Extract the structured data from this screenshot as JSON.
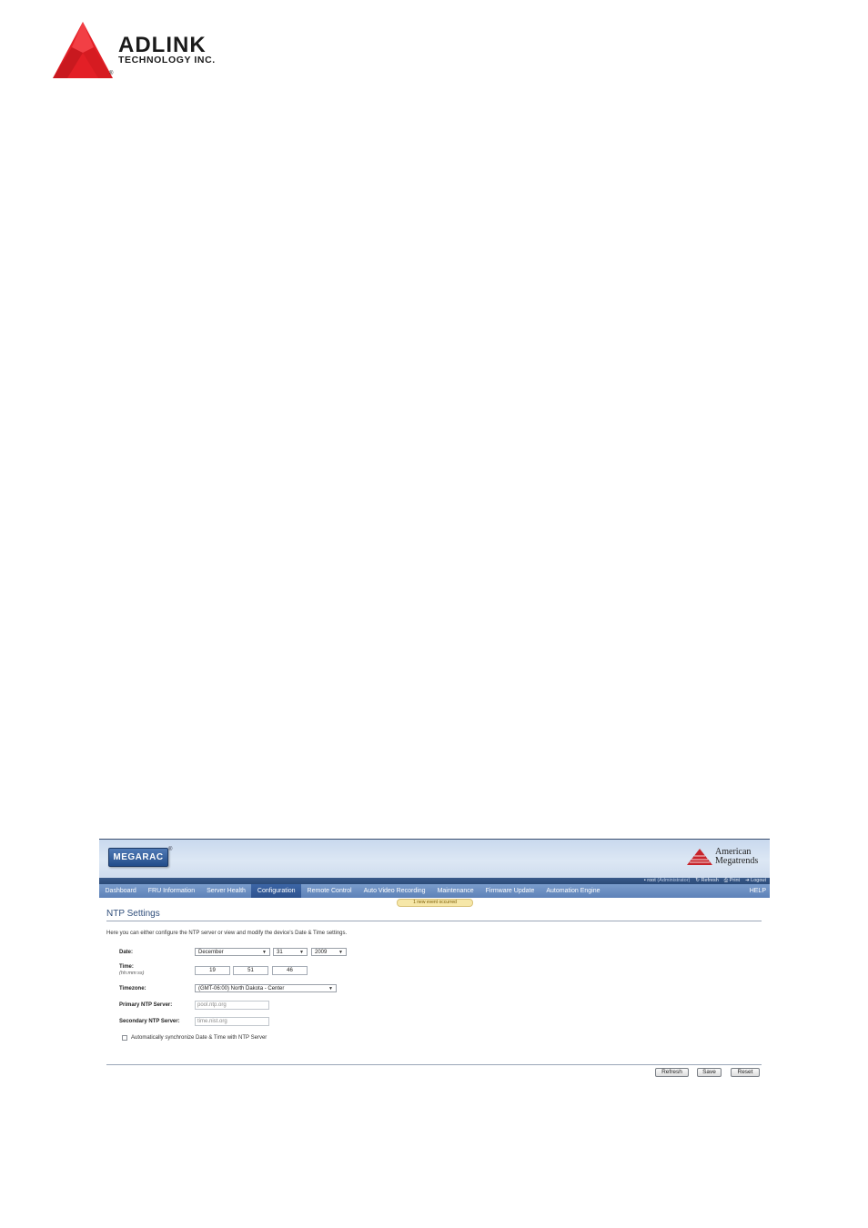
{
  "document": {
    "brand_name": "ADLINK",
    "brand_sub": "TECHNOLOGY INC.",
    "brand_reg": "®"
  },
  "app": {
    "logo_text": "MEGARAC",
    "logo_reg": "®",
    "vendor_line1": "American",
    "vendor_line2": "Megatrends",
    "user": "root",
    "role": "(Administrator)",
    "refresh": "Refresh",
    "print": "Print",
    "logout": "Logout"
  },
  "nav": {
    "items": [
      "Dashboard",
      "FRU Information",
      "Server Health",
      "Configuration",
      "Remote Control",
      "Auto Video Recording",
      "Maintenance",
      "Firmware Update",
      "Automation Engine"
    ],
    "active_index": 3,
    "help": "HELP"
  },
  "event_notice": "1 new event occurred",
  "page": {
    "title": "NTP Settings",
    "intro": "Here you can either configure the NTP server or view and modify the device's Date & Time settings."
  },
  "form": {
    "date_label": "Date:",
    "month": "December",
    "day": "31",
    "year": "2009",
    "time_label": "Time:",
    "time_hint": "(hh:mm:ss)",
    "hour": "19",
    "minute": "51",
    "second": "46",
    "timezone_label": "Timezone:",
    "timezone": "(GMT-06:00) North Dakota - Center",
    "primary_label": "Primary NTP Server:",
    "primary_value": "pool.ntp.org",
    "secondary_label": "Secondary NTP Server:",
    "secondary_value": "time.nist.org",
    "auto_sync_label": "Automatically synchronize Date & Time with NTP Server",
    "auto_sync_checked": false
  },
  "buttons": {
    "refresh": "Refresh",
    "save": "Save",
    "reset": "Reset"
  },
  "colors": {
    "brand_red": "#e31f26",
    "nav_blue": "#5e82b8",
    "active_tab": "#2d528e",
    "title_blue": "#2f4d7a"
  }
}
